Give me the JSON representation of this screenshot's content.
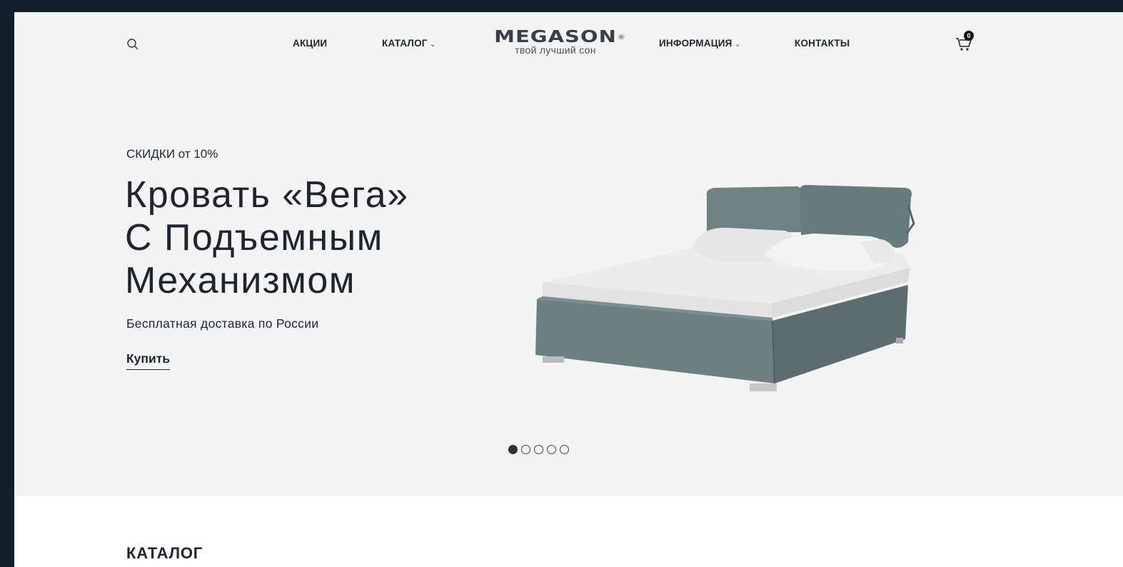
{
  "header": {
    "nav": [
      {
        "label": "АКЦИИ"
      },
      {
        "label": "КАТАЛОГ",
        "chevron": "⌄"
      },
      {
        "label": "ИНФОРМАЦИЯ",
        "chevron": "⌄"
      },
      {
        "label": "КОНТАКТЫ"
      }
    ],
    "logo": {
      "word": "MEGASON",
      "registered": "®",
      "tagline": "твой лучший сон"
    },
    "cart_count": "0",
    "icons": {
      "search": "search-icon",
      "cart": "cart-icon"
    }
  },
  "hero": {
    "eyebrow": "СКИДКИ от 10%",
    "title_lines": [
      "Кровать «Вега»",
      "С Подъемным",
      "Механизмом"
    ],
    "subtitle": "Бесплатная доставка по России",
    "cta": "Купить",
    "slides_total": 5,
    "active_slide": 1
  },
  "catalog": {
    "heading": "КАТАЛОГ"
  },
  "colors": {
    "page_bg": "#13202b",
    "hero_bg": "#f4f4f4",
    "text": "#1d2530",
    "bed_fabric": "#6b7e80",
    "bed_sheet": "#ececec"
  }
}
